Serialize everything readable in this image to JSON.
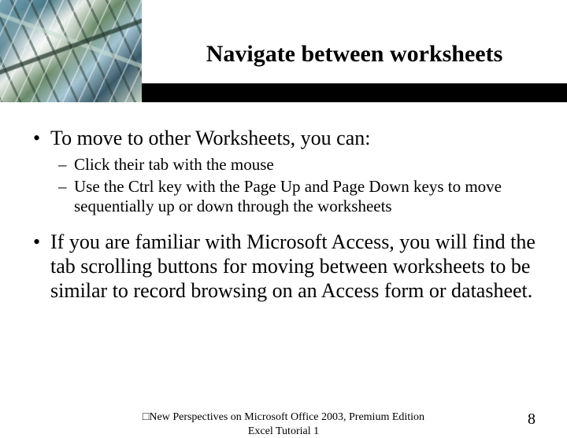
{
  "title": "Navigate between worksheets",
  "bullets": {
    "b1": "To move to other Worksheets, you can:",
    "b1_sub1": "Click their tab with the mouse",
    "b1_sub2": "Use the Ctrl key with the Page Up and Page Down keys to move sequentially up or down through the worksheets",
    "b2": "If you are familiar with Microsoft Access, you will find the tab scrolling buttons for moving between worksheets to be similar to record browsing on an Access form or datasheet."
  },
  "footer": {
    "line1": "□New Perspectives on Microsoft Office 2003, Premium Edition",
    "line2": "Excel Tutorial 1",
    "page": "8"
  }
}
